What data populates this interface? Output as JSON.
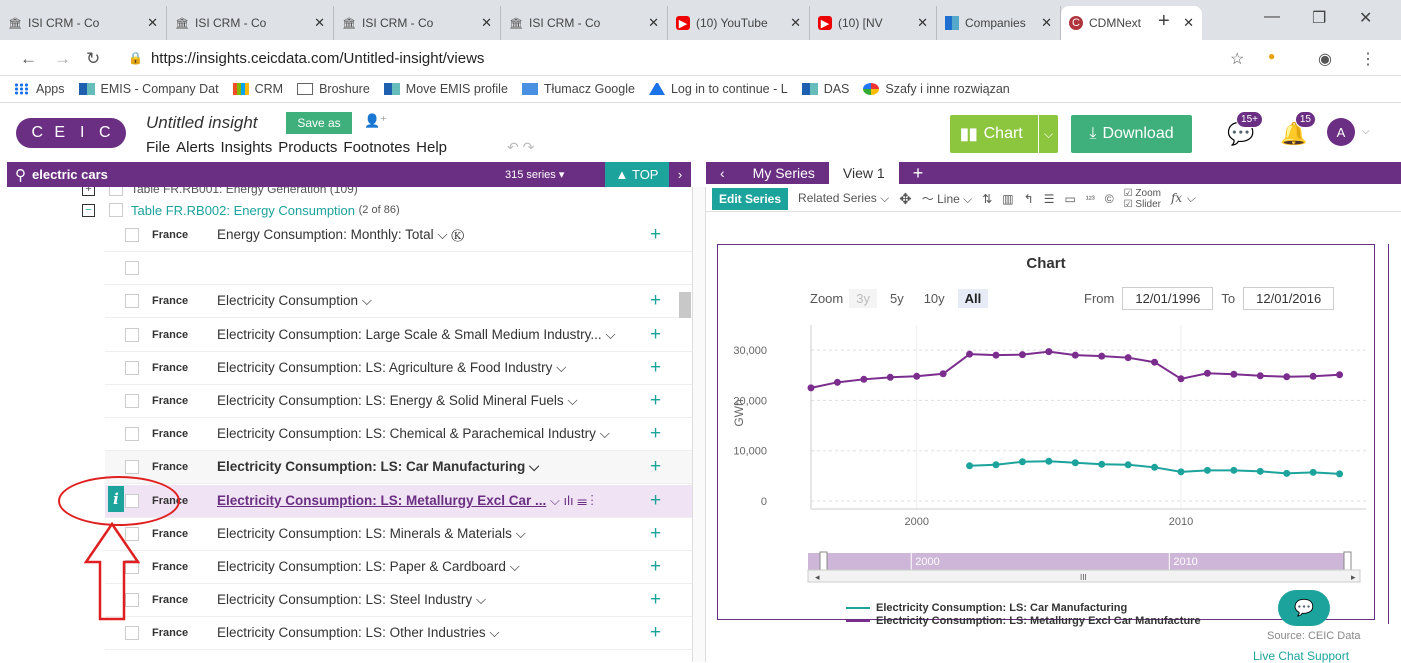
{
  "browser": {
    "tabs": [
      {
        "label": "ISI CRM - Co",
        "icon": "ceic-icon",
        "active": false
      },
      {
        "label": "ISI CRM - Co",
        "icon": "ceic-icon",
        "active": false
      },
      {
        "label": "ISI CRM - Co",
        "icon": "ceic-icon",
        "active": false
      },
      {
        "label": "ISI CRM - Co",
        "icon": "ceic-icon",
        "active": false
      },
      {
        "label": "(10) YouTube",
        "icon": "youtube-icon",
        "active": false
      },
      {
        "label": "(10) [NV",
        "icon": "youtube-icon",
        "active": false
      },
      {
        "label": "Companies",
        "icon": "ms-icon",
        "active": false
      },
      {
        "label": "CDMNext",
        "icon": "cdm-icon",
        "active": true
      }
    ],
    "url": "https://insights.ceicdata.com/Untitled-insight/views",
    "bookmarks": [
      {
        "label": "Apps",
        "icon": "grid"
      },
      {
        "label": "EMIS - Company Dat",
        "icon": "ms"
      },
      {
        "label": "CRM",
        "icon": "crm"
      },
      {
        "label": "Broshure",
        "icon": "doc"
      },
      {
        "label": "Move EMIS profile",
        "icon": "ms"
      },
      {
        "label": "Tłumacz Google",
        "icon": "tr"
      },
      {
        "label": "Log in to continue - L",
        "icon": "a"
      },
      {
        "label": "DAS",
        "icon": "ms"
      },
      {
        "label": "Szafy i inne rozwiązan",
        "icon": "sz"
      }
    ]
  },
  "app": {
    "logo_letters": [
      "C",
      "E",
      "I",
      "C"
    ],
    "insight_title": "Untitled insight",
    "save_as": "Save as",
    "menu": [
      "File",
      "Alerts",
      "Insights",
      "Products",
      "Footnotes",
      "Help"
    ],
    "chart_button": "Chart",
    "download_button": "Download",
    "messages_badge": "15+",
    "notifications_badge": "15",
    "avatar_letter": "A"
  },
  "search": {
    "query": "electric cars",
    "count": "315 series",
    "top_label": "TOP"
  },
  "tree": {
    "table1": "Table FR.RB001: Energy Generation (109)",
    "table2": "Table FR.RB002: Energy Consumption",
    "table2_count": "(2 of 86)"
  },
  "series": [
    {
      "country": "France",
      "name": "Energy Consumption: Monthly: Total ⌵ Ⓚ",
      "style": ""
    },
    {
      "country": "",
      "name": "",
      "style": ""
    },
    {
      "country": "France",
      "name": "Electricity Consumption ⌵",
      "style": ""
    },
    {
      "country": "France",
      "name": "Electricity Consumption: Large Scale & Small Medium Industry... ⌵",
      "style": ""
    },
    {
      "country": "France",
      "name": "Electricity Consumption: LS: Agriculture & Food Industry ⌵",
      "style": ""
    },
    {
      "country": "France",
      "name": "Electricity Consumption: LS: Energy & Solid Mineral Fuels ⌵",
      "style": ""
    },
    {
      "country": "France",
      "name": "Electricity Consumption: LS: Chemical & Parachemical Industry ⌵",
      "style": ""
    },
    {
      "country": "France",
      "name": "Electricity Consumption: LS: Car Manufacturing ⌵",
      "style": "bold gray"
    },
    {
      "country": "France",
      "name": "Electricity Consumption: LS: Metallurgy Excl Car ...",
      "style": "hl"
    },
    {
      "country": "France",
      "name": "Electricity Consumption: LS: Minerals & Materials ⌵",
      "style": ""
    },
    {
      "country": "France",
      "name": "Electricity Consumption: LS: Paper & Cardboard ⌵",
      "style": ""
    },
    {
      "country": "France",
      "name": "Electricity Consumption: LS: Steel Industry ⌵",
      "style": ""
    },
    {
      "country": "France",
      "name": "Electricity Consumption: LS: Other Industries ⌵",
      "style": ""
    }
  ],
  "right_panel": {
    "tabs": [
      "My Series",
      "View 1"
    ],
    "toolbar": {
      "edit_series": "Edit Series",
      "related_series": "Related Series ⌵",
      "line": "Line ⌵",
      "zoom_label": "Zoom",
      "slider_label": "Slider",
      "fx": "fx ⌵"
    }
  },
  "chart_data": {
    "type": "line",
    "title": "Chart",
    "zoom_label": "Zoom",
    "zoom_options": [
      "3y",
      "5y",
      "10y",
      "All"
    ],
    "zoom_selected": "All",
    "from_label": "From",
    "from_date": "12/01/1996",
    "to_label": "To",
    "to_date": "12/01/2016",
    "ylabel": "GWh",
    "ylim": [
      0,
      35000
    ],
    "yticks": [
      "0",
      "10,000",
      "20,000",
      "30,000"
    ],
    "xticks": [
      "2000",
      "2010"
    ],
    "navigator_ticks": [
      "2000",
      "2010"
    ],
    "xlim": [
      1996,
      2017
    ],
    "series": [
      {
        "name": "Electricity Consumption: LS: Car Manufacturing",
        "color": "#1ba39c",
        "x": [
          2002,
          2003,
          2004,
          2005,
          2006,
          2007,
          2008,
          2009,
          2010,
          2011,
          2012,
          2013,
          2014,
          2015,
          2016
        ],
        "values": [
          7000,
          7200,
          7800,
          7900,
          7600,
          7300,
          7200,
          6700,
          5800,
          6100,
          6100,
          5900,
          5500,
          5700,
          5400
        ]
      },
      {
        "name": "Electricity Consumption: LS: Metallurgy Excl Car Manufacture",
        "color": "#7b2d8e",
        "x": [
          1996,
          1997,
          1998,
          1999,
          2000,
          2001,
          2002,
          2003,
          2004,
          2005,
          2006,
          2007,
          2008,
          2009,
          2010,
          2011,
          2012,
          2013,
          2014,
          2015,
          2016
        ],
        "values": [
          22500,
          23600,
          24200,
          24600,
          24800,
          25300,
          29200,
          29000,
          29100,
          29700,
          29000,
          28800,
          28500,
          27600,
          24300,
          25400,
          25200,
          24900,
          24700,
          24800,
          25100
        ]
      }
    ]
  },
  "source_text": "Source: CEIC Data",
  "live_chat": "Live Chat Support"
}
